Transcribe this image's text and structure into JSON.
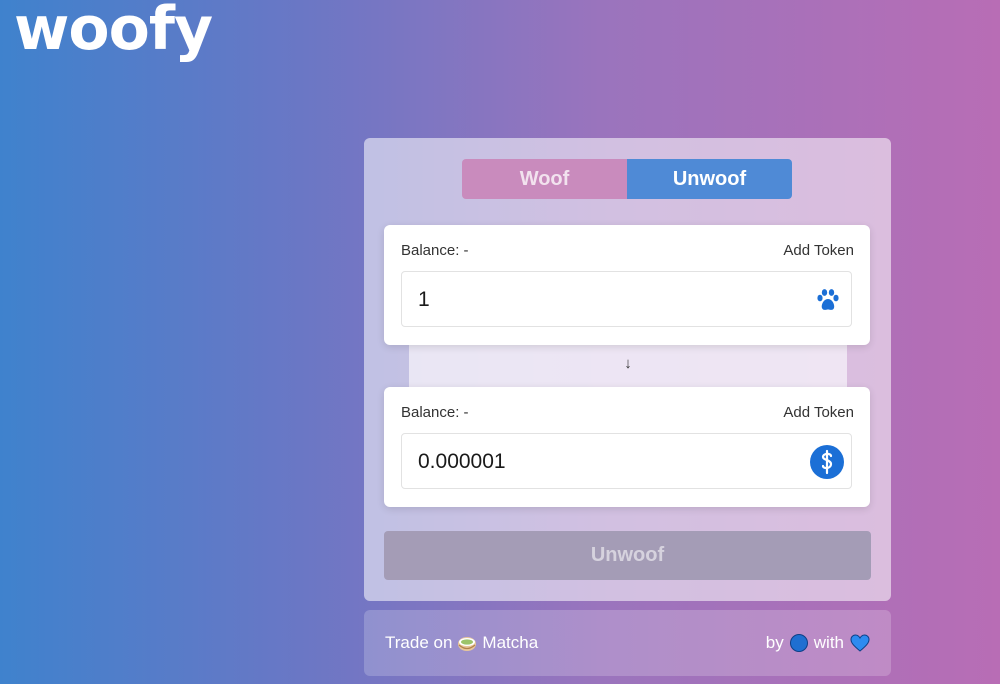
{
  "app": {
    "logo": "woofy"
  },
  "tabs": [
    {
      "label": "Woof",
      "active": false
    },
    {
      "label": "Unwoof",
      "active": true
    }
  ],
  "input_card": {
    "balance_label": "Balance: -",
    "add_token_label": "Add Token",
    "amount": "1",
    "token_icon": "paw-icon"
  },
  "arrow": "↓",
  "output_card": {
    "balance_label": "Balance: -",
    "add_token_label": "Add Token",
    "amount": "0.000001",
    "token_icon": "yfi-icon"
  },
  "action_button": {
    "label": "Unwoof",
    "disabled": true
  },
  "footer": {
    "trade_prefix": "Trade on",
    "trade_link": "Matcha",
    "by_label": "by",
    "with_label": "with"
  },
  "colors": {
    "active_tab": "#4f8ad6",
    "inactive_tab": "#c98bbd",
    "icon_blue": "#1b6fd6"
  }
}
